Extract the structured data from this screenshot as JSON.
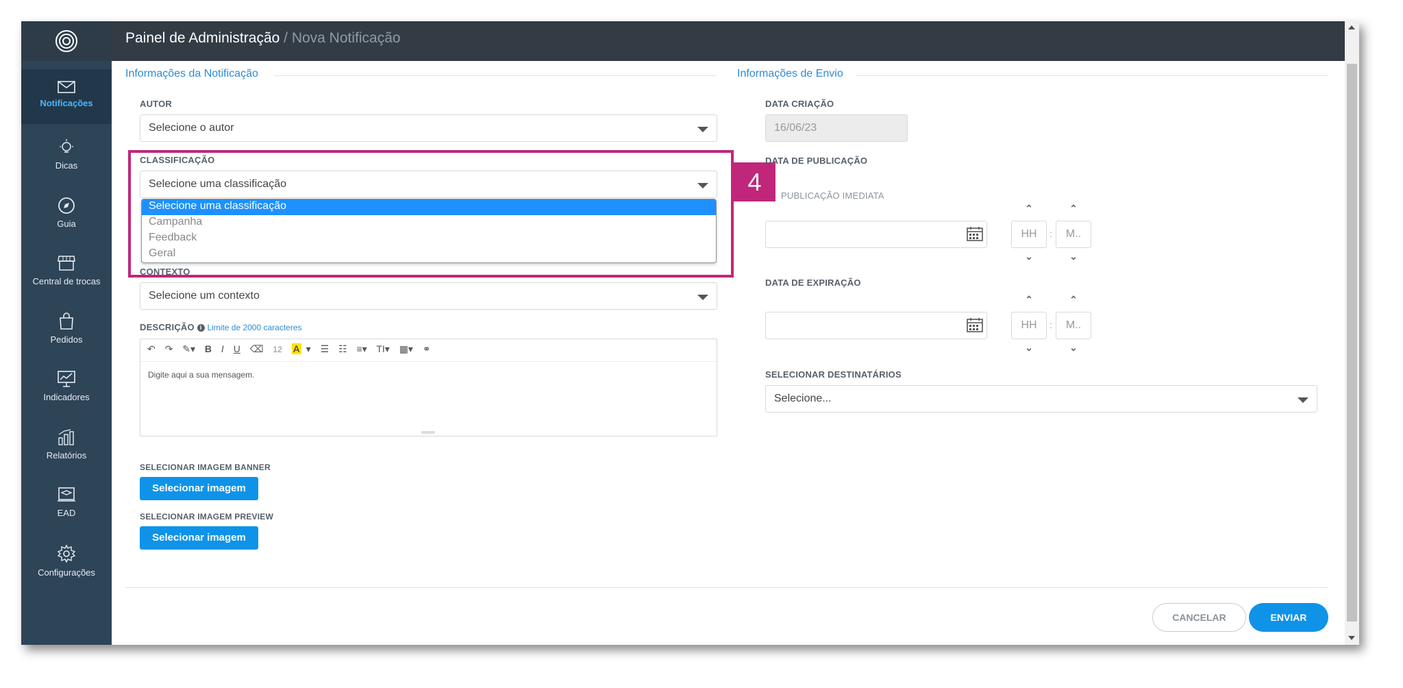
{
  "app": {
    "title": "Painel de Administração",
    "breadcrumb_sep": " / ",
    "subtitle": "Nova Notificação"
  },
  "sidebar": {
    "items": [
      {
        "label": "Notificações",
        "icon": "envelope-icon"
      },
      {
        "label": "Dicas",
        "icon": "lightbulb-icon"
      },
      {
        "label": "Guia",
        "icon": "compass-icon"
      },
      {
        "label": "Central de trocas",
        "icon": "store-icon"
      },
      {
        "label": "Pedidos",
        "icon": "shopping-bag-icon"
      },
      {
        "label": "Indicadores",
        "icon": "chart-board-icon"
      },
      {
        "label": "Relatórios",
        "icon": "bar-report-icon"
      },
      {
        "label": "EAD",
        "icon": "graduation-icon"
      },
      {
        "label": "Configurações",
        "icon": "gear-icon"
      }
    ]
  },
  "left_section": {
    "legend": "Informações da Notificação",
    "autor": {
      "label": "AUTOR",
      "value": "Selecione o autor"
    },
    "classificacao": {
      "label": "CLASSIFICAÇÃO",
      "value": "Selecione uma classificação",
      "options": [
        "Selecione uma classificação",
        "Campanha",
        "Feedback",
        "Geral"
      ]
    },
    "contexto": {
      "label": "CONTEXTO",
      "value": "Selecione um contexto"
    },
    "descricao": {
      "label": "DESCRIÇÃO",
      "info_icon": "i",
      "hint": "Limite de 2000 caracteres",
      "placeholder": "Digite aqui a sua mensagem.",
      "toolbar": [
        "↶",
        "↷",
        "✎▾",
        "B",
        "I",
        "U",
        "⌫",
        "12",
        "A",
        "▾",
        "☰",
        "☷",
        "≡▾",
        "TI▾",
        "▦▾",
        "⚭"
      ]
    },
    "banner": {
      "label": "SELECIONAR IMAGEM BANNER",
      "button": "Selecionar imagem"
    },
    "preview": {
      "label": "SELECIONAR IMAGEM PREVIEW",
      "button": "Selecionar imagem"
    }
  },
  "right_section": {
    "legend": "Informações de Envio",
    "data_criacao": {
      "label": "DATA CRIAÇÃO",
      "value": "16/06/23"
    },
    "data_publicacao": {
      "label": "DATA DE PUBLICAÇÃO",
      "immediate": "PUBLICAÇÃO IMEDIATA",
      "hh": "HH",
      "mm": "M.."
    },
    "data_expiracao": {
      "label": "DATA DE EXPIRAÇÃO",
      "hh": "HH",
      "mm": "M.."
    },
    "destinatarios": {
      "label": "SELECIONAR DESTINATÁRIOS",
      "value": "Selecione..."
    }
  },
  "annotation": {
    "step": "4",
    "color": "#c0267a"
  },
  "footer": {
    "cancel": "CANCELAR",
    "send": "ENVIAR"
  },
  "colors": {
    "accent": "#0f93e8",
    "sidebar": "#2e4457",
    "topbar": "#333c45"
  }
}
